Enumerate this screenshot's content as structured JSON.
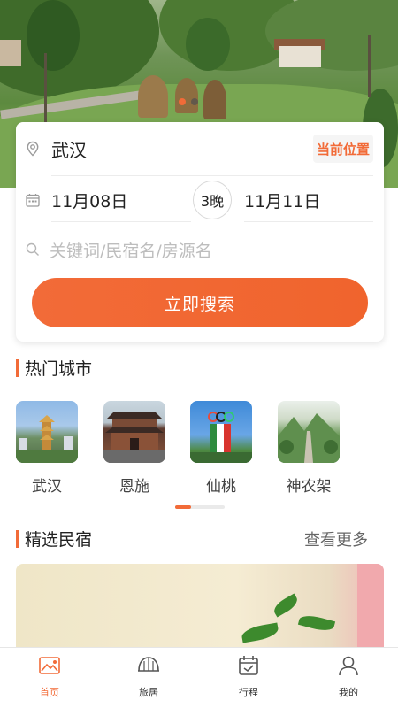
{
  "hero": {
    "carousel_dots": 2,
    "active_dot": 0
  },
  "search": {
    "city": "武汉",
    "location_button": "当前位置",
    "checkin": "11月08日",
    "nights": "3晚",
    "checkout": "11月11日",
    "keyword_placeholder": "关键词/民宿名/房源名",
    "search_button": "立即搜索"
  },
  "hot_cities": {
    "title": "热门城市",
    "items": [
      {
        "name": "武汉"
      },
      {
        "name": "恩施"
      },
      {
        "name": "仙桃"
      },
      {
        "name": "神农架"
      }
    ]
  },
  "featured": {
    "title": "精选民宿",
    "more": "查看更多"
  },
  "tabbar": {
    "items": [
      {
        "label": "首页",
        "icon": "home-icon"
      },
      {
        "label": "旅居",
        "icon": "house-icon"
      },
      {
        "label": "行程",
        "icon": "calendar-icon"
      },
      {
        "label": "我的",
        "icon": "user-icon"
      }
    ]
  },
  "colors": {
    "accent": "#f26b38"
  }
}
